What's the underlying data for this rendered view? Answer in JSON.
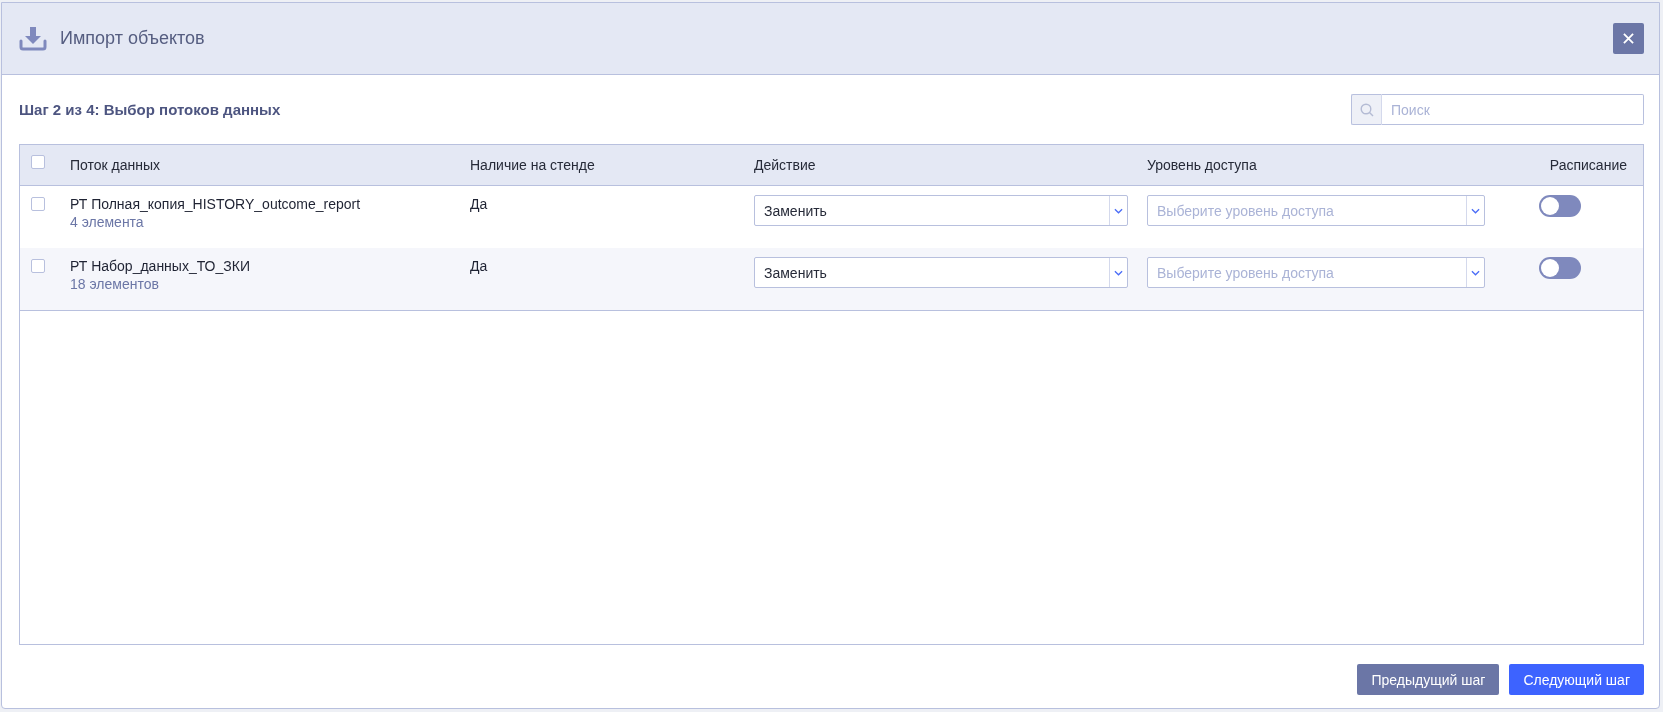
{
  "dialog": {
    "title": "Импорт объектов"
  },
  "step": {
    "title": "Шаг 2 из 4: Выбор потоков данных"
  },
  "search": {
    "placeholder": "Поиск"
  },
  "table": {
    "select_all": {
      "checked": false
    },
    "columns": [
      "Поток данных",
      "Наличие на стенде",
      "Действие",
      "Уровень доступа",
      "Расписание"
    ],
    "rows": [
      {
        "checked": false,
        "name": "РТ Полная_копия_HISTORY_outcome_report",
        "count": "4 элемента",
        "presence": "Да",
        "action": {
          "value": "Заменить"
        },
        "access_level": {
          "placeholder": "Выберите уровень доступа"
        },
        "schedule": {
          "on": false
        }
      },
      {
        "checked": false,
        "name": "РТ Набор_данных_ТО_ЗКИ",
        "count": "18 элементов",
        "presence": "Да",
        "action": {
          "value": "Заменить"
        },
        "access_level": {
          "placeholder": "Выберите уровень доступа"
        },
        "schedule": {
          "on": false
        }
      }
    ]
  },
  "buttons": [
    {
      "label": "Предыдущий шаг",
      "kind": "secondary"
    },
    {
      "label": "Следующий шаг",
      "kind": "primary"
    }
  ]
}
